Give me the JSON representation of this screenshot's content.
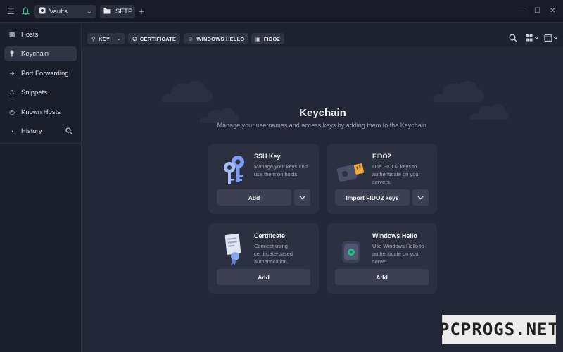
{
  "titlebar": {
    "vault_label": "Vaults",
    "sftp_label": "SFTP",
    "new_tab": "+"
  },
  "sidebar": {
    "items": [
      {
        "label": "Hosts",
        "icon": "grid-icon"
      },
      {
        "label": "Keychain",
        "icon": "key-icon"
      },
      {
        "label": "Port Forwarding",
        "icon": "arrow-icon"
      },
      {
        "label": "Snippets",
        "icon": "braces-icon"
      },
      {
        "label": "Known Hosts",
        "icon": "globe-icon"
      },
      {
        "label": "History",
        "icon": "clock-icon"
      }
    ],
    "active": "Keychain"
  },
  "filters": {
    "key": "KEY",
    "certificate": "CERTIFICATE",
    "windows_hello": "WINDOWS HELLO",
    "fido2": "FIDO2"
  },
  "main": {
    "title": "Keychain",
    "subtitle": "Manage your usernames and access keys by adding them to the Keychain.",
    "cards": {
      "ssh": {
        "title": "SSH Key",
        "desc": "Manage your keys and use them on hosts.",
        "button": "Add"
      },
      "fido": {
        "title": "FIDO2",
        "desc": "Use FIDO2 keys to authenticate on your servers.",
        "button": "Import FIDO2 keys"
      },
      "cert": {
        "title": "Certificate",
        "desc": "Connect using certificate-based authentication.",
        "button": "Add"
      },
      "hello": {
        "title": "Windows Hello",
        "desc": "Use Windows Hello to authenticate on your server.",
        "button": "Add"
      }
    }
  },
  "watermark": "PCPROGS.NET",
  "colors": {
    "background": "#1f2331",
    "sidebar": "#1b1e2b",
    "card": "#2c3142",
    "accent_key": "#8fb0ff",
    "accent_fido": "#ffb02e"
  }
}
